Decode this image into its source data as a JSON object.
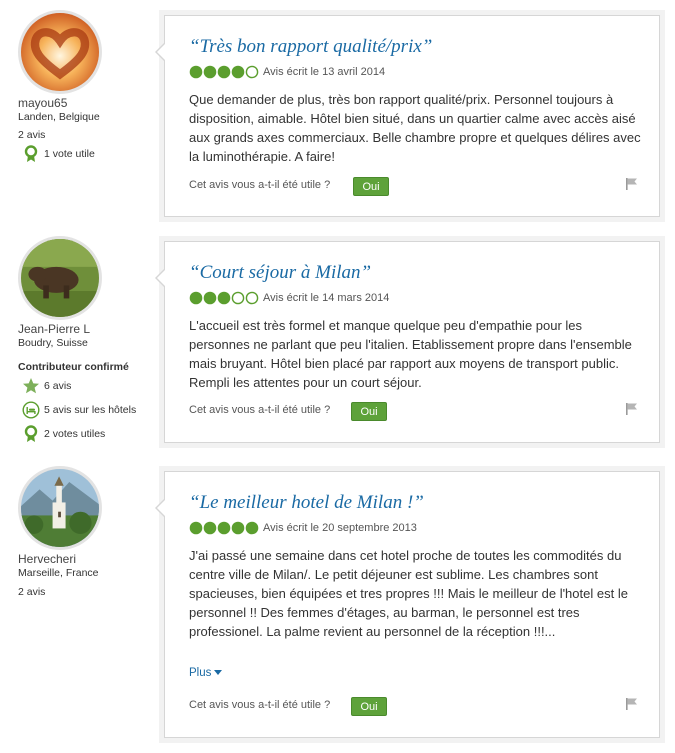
{
  "colors": {
    "accent_blue": "#1a6aa4",
    "bubble_green": "#5b9e2e",
    "button_green": "#5ea23a"
  },
  "reviews": [
    {
      "user": {
        "name": "mayou65",
        "location": "Landen, Belgique",
        "badge": ""
      },
      "stats": [
        {
          "icon": "",
          "text": "2 avis"
        },
        {
          "icon": "ribbon-icon",
          "text": "1 vote utile"
        }
      ],
      "title": "“Très bon rapport qualité/prix”",
      "rating": 4,
      "date": "Avis écrit le 13 avril 2014",
      "body": "Que demander de plus, très bon rapport qualité/prix. Personnel toujours à disposition, aimable. Hôtel bien situé, dans un quartier calme avec accès aisé aux grands axes commerciaux. Belle chambre propre et quelques délires avec la luminothérapie. A faire!",
      "more": "",
      "helpful_question": "Cet avis vous a-t-il été utile ?",
      "yes_label": "Oui"
    },
    {
      "user": {
        "name": "Jean-Pierre L",
        "location": "Boudry, Suisse",
        "badge": "Contributeur confirmé"
      },
      "stats": [
        {
          "icon": "star-icon",
          "text": "6 avis"
        },
        {
          "icon": "hotel-bed-icon",
          "text": "5 avis sur les hôtels"
        },
        {
          "icon": "ribbon-icon",
          "text": "2 votes utiles"
        }
      ],
      "title": "“Court séjour à Milan”",
      "rating": 3,
      "date": "Avis écrit le 14 mars 2014",
      "body": "L'accueil est très formel et manque quelque peu d'empathie pour les personnes ne parlant que peu l'italien. Etablissement propre dans l'ensemble mais bruyant. Hôtel bien placé par rapport aux moyens de transport public. Rempli les attentes pour un court séjour.",
      "more": "",
      "helpful_question": "Cet avis vous a-t-il été utile ?",
      "yes_label": "Oui"
    },
    {
      "user": {
        "name": "Hervecheri",
        "location": "Marseille, France",
        "badge": ""
      },
      "stats": [
        {
          "icon": "",
          "text": "2 avis"
        }
      ],
      "title": "“Le meilleur hotel de Milan !”",
      "rating": 5,
      "date": "Avis écrit le 20 septembre 2013",
      "body": "J'ai passé une semaine dans cet hotel proche de toutes les commodités du centre ville de Milan/. Le petit déjeuner est sublime. Les chambres sont spacieuses, bien équipées et tres propres !!! Mais le meilleur de l'hotel est le personnel !! Des femmes d'étages, au barman, le personnel est tres professionel. La palme revient au personnel de la réception !!!...",
      "more": "Plus",
      "helpful_question": "Cet avis vous a-t-il été utile ?",
      "yes_label": "Oui"
    }
  ]
}
